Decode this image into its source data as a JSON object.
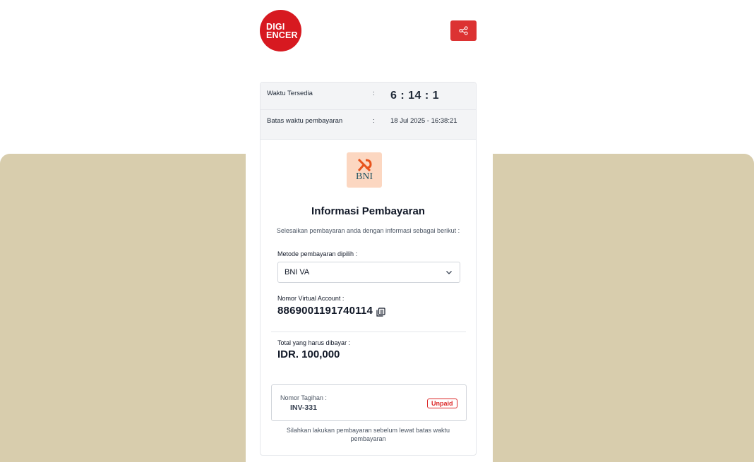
{
  "brand": {
    "logo_line1": "DIGI",
    "logo_line2": "ENCER",
    "accent": "#d71920"
  },
  "header": {
    "share_icon": "share-icon"
  },
  "timer": {
    "available_label": "Waktu Tersedia",
    "available_sep": ":",
    "available_value": "6 : 14 : 1",
    "deadline_label": "Batas waktu pembayaran",
    "deadline_sep": ":",
    "deadline_value": "18 Jul 2025 - 16:38:21"
  },
  "bank": {
    "logo_text": "BNI"
  },
  "payment": {
    "title": "Informasi Pembayaran",
    "subtitle": "Selesaikan pembayaran anda dengan informasi sebagai berikut :",
    "method_label": "Metode pembayaran dipilih :",
    "method_value": "BNI VA",
    "va_label": "Nomor Virtual Account :",
    "va_number": "8869001191740114",
    "total_label": "Total yang harus dibayar :",
    "total_value": "IDR. 100,000"
  },
  "invoice": {
    "label": "Nomor Tagihan :",
    "number": "INV-331",
    "status": "Unpaid",
    "status_color": "#dc2626"
  },
  "note": "Silahkan lakukan pembayaran sebelum lewat batas waktu pembayaran"
}
